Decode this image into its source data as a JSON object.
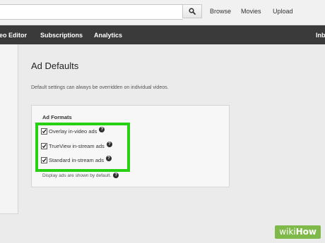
{
  "topbar": {
    "search": {
      "value": "",
      "placeholder": ""
    },
    "nav": [
      "Browse",
      "Movies",
      "Upload"
    ]
  },
  "darknav": {
    "items": [
      "eo Editor",
      "Subscriptions",
      "Analytics",
      "Inb"
    ]
  },
  "section": {
    "title": "Ad Defaults",
    "description": "Default settings can always be overridden on individual videos."
  },
  "ad_formats": {
    "title": "Ad Formats",
    "options": [
      {
        "label": "Overlay in-video ads",
        "checked": true
      },
      {
        "label": "TrueView in-stream ads",
        "checked": true
      },
      {
        "label": "Standard in-stream ads",
        "checked": true
      }
    ],
    "note": "Display ads are shown by default."
  },
  "watermark": {
    "part1": "wiki",
    "part2": "How"
  },
  "colors": {
    "highlight": "#27d012",
    "darknav": "#3a3a3a",
    "watermark": "#7fb94a"
  }
}
